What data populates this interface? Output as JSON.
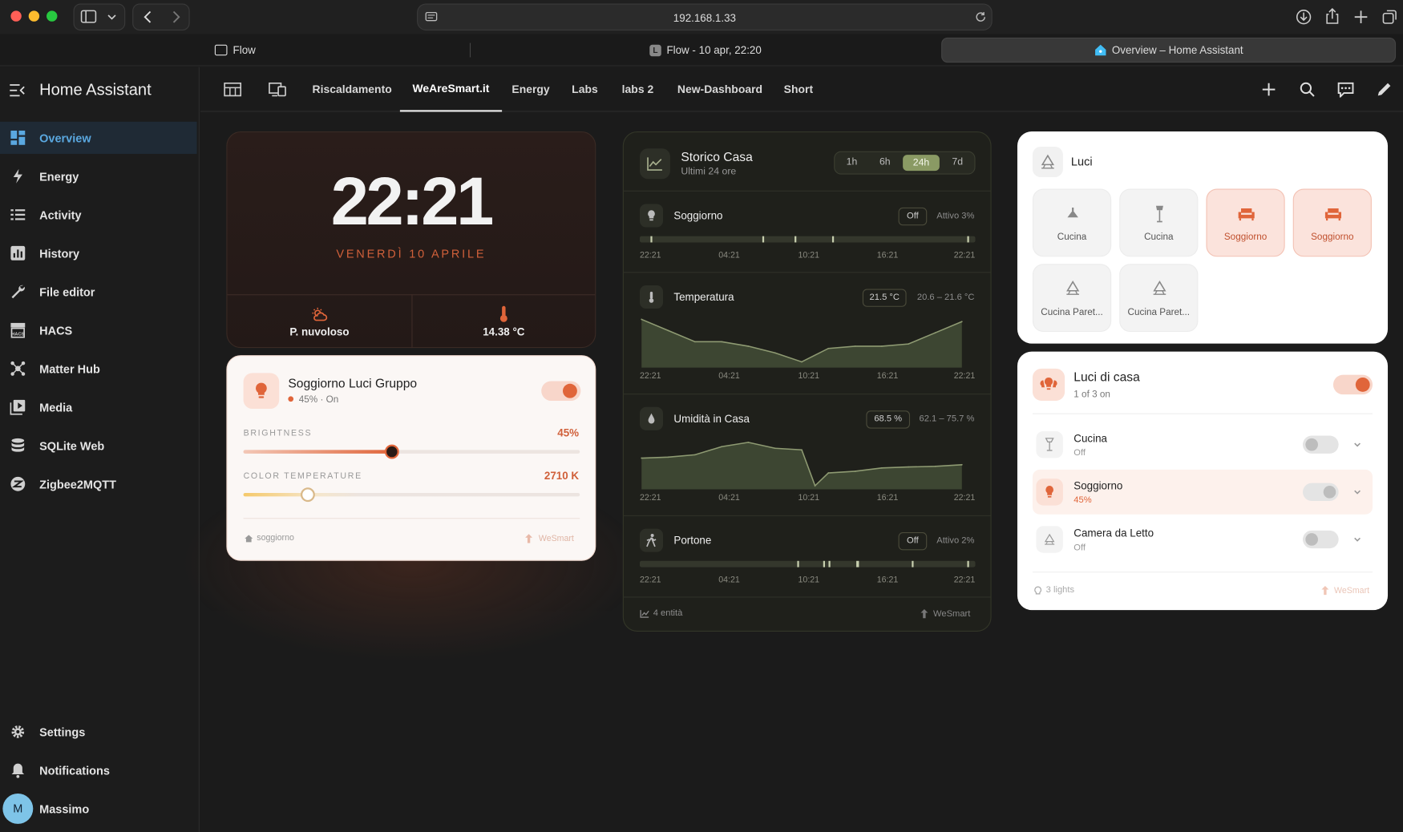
{
  "browser": {
    "url": "192.168.1.33",
    "tabs": [
      {
        "label": "Flow"
      },
      {
        "label": "Flow - 10 apr, 22:20"
      },
      {
        "label": "Overview – Home Assistant"
      }
    ]
  },
  "sidebar": {
    "title": "Home Assistant",
    "items": [
      {
        "label": "Overview",
        "icon": "overview-icon"
      },
      {
        "label": "Energy",
        "icon": "lightning-icon"
      },
      {
        "label": "Activity",
        "icon": "list-icon"
      },
      {
        "label": "History",
        "icon": "chart-bar-icon"
      },
      {
        "label": "File editor",
        "icon": "wrench-icon"
      },
      {
        "label": "HACS",
        "icon": "hacs-icon"
      },
      {
        "label": "Matter Hub",
        "icon": "hub-icon"
      },
      {
        "label": "Media",
        "icon": "media-icon"
      },
      {
        "label": "SQLite Web",
        "icon": "database-icon"
      },
      {
        "label": "Zigbee2MQTT",
        "icon": "zigbee-icon"
      }
    ],
    "bottom": [
      {
        "label": "Settings",
        "icon": "gear-icon"
      },
      {
        "label": "Notifications",
        "icon": "bell-icon"
      }
    ],
    "user": {
      "name": "Massimo",
      "initial": "M"
    }
  },
  "header": {
    "tabs": [
      "Riscaldamento",
      "WeAreSmart.it",
      "Energy",
      "Labs",
      "labs 2",
      "New-Dashboard",
      "Short"
    ],
    "selected_tab": "WeAreSmart.it"
  },
  "clock_card": {
    "time": "22:21",
    "date": "VENERDÌ 10 APRILE",
    "weather": "P. nuvoloso",
    "temperature": "14.38 °C"
  },
  "light_group_card": {
    "title": "Soggiorno Luci Gruppo",
    "status": "45% · On",
    "brightness_label": "BRIGHTNESS",
    "brightness_value": "45%",
    "brightness_fraction": 0.45,
    "color_temp_label": "COLOR TEMPERATURE",
    "color_temp_value": "2710 K",
    "room": "soggiorno",
    "brand": "WeSmart"
  },
  "history_card": {
    "title": "Storico Casa",
    "subtitle": "Ultimi 24 ore",
    "ranges": [
      "1h",
      "6h",
      "24h",
      "7d"
    ],
    "selected_range": "24h",
    "x_ticks": [
      "22:21",
      "04:21",
      "10:21",
      "16:21",
      "22:21"
    ],
    "rows": [
      {
        "name": "Soggiorno",
        "state": "Off",
        "extra": "Attivo 3%"
      },
      {
        "name": "Temperatura",
        "state": "21.5 °C",
        "extra": "20.6 – 21.6 °C"
      },
      {
        "name": "Umidità in Casa",
        "state": "68.5 %",
        "extra": "62.1 – 75.7 %"
      },
      {
        "name": "Portone",
        "state": "Off",
        "extra": "Attivo 2%"
      }
    ],
    "footer_count": "4 entità",
    "brand": "WeSmart"
  },
  "chart_data": [
    {
      "type": "area",
      "title": "Temperatura",
      "unit": "°C",
      "x": [
        "22:21",
        "00:21",
        "02:21",
        "04:21",
        "06:21",
        "08:21",
        "10:21",
        "12:21",
        "14:21",
        "16:21",
        "18:21",
        "20:21",
        "22:21"
      ],
      "values": [
        21.6,
        21.35,
        21.1,
        21.1,
        21.0,
        20.85,
        20.65,
        20.95,
        21.0,
        21.0,
        21.05,
        21.3,
        21.55
      ],
      "ylim": [
        20.6,
        21.6
      ]
    },
    {
      "type": "area",
      "title": "Umidità in Casa",
      "unit": "%",
      "x": [
        "22:21",
        "00:21",
        "02:21",
        "04:21",
        "06:21",
        "08:21",
        "10:21",
        "11:21",
        "12:21",
        "14:21",
        "16:21",
        "18:21",
        "20:21",
        "22:21"
      ],
      "values": [
        70.5,
        70.8,
        71.5,
        74.0,
        75.3,
        73.5,
        73.0,
        62.1,
        66.0,
        66.5,
        67.5,
        67.8,
        68.0,
        68.5
      ],
      "ylim": [
        62.1,
        75.7
      ]
    }
  ],
  "luci_card": {
    "title": "Luci",
    "buttons": [
      {
        "label": "Cucina",
        "on": false,
        "icon": "ceiling-light-icon"
      },
      {
        "label": "Cucina",
        "on": false,
        "icon": "floor-lamp-icon"
      },
      {
        "label": "Soggiorno",
        "on": true,
        "icon": "sofa-icon"
      },
      {
        "label": "Soggiorno",
        "on": true,
        "icon": "sofa-icon"
      },
      {
        "label": "Cucina Paret...",
        "on": false,
        "icon": "wall-light-icon"
      },
      {
        "label": "Cucina Paret...",
        "on": false,
        "icon": "wall-light-icon"
      }
    ]
  },
  "luci_casa_card": {
    "title": "Luci di casa",
    "summary": "1 of 3 on",
    "lights": [
      {
        "name": "Cucina",
        "state": "Off",
        "on": false
      },
      {
        "name": "Soggiorno",
        "state": "45%",
        "on": true
      },
      {
        "name": "Camera da Letto",
        "state": "Off",
        "on": false
      }
    ],
    "footer_count": "3 lights",
    "brand": "WeSmart"
  },
  "colors": {
    "accent": "#e0653a",
    "sidebar_selected": "#5aa8e0",
    "chart_fill": "#4c5a3c"
  }
}
